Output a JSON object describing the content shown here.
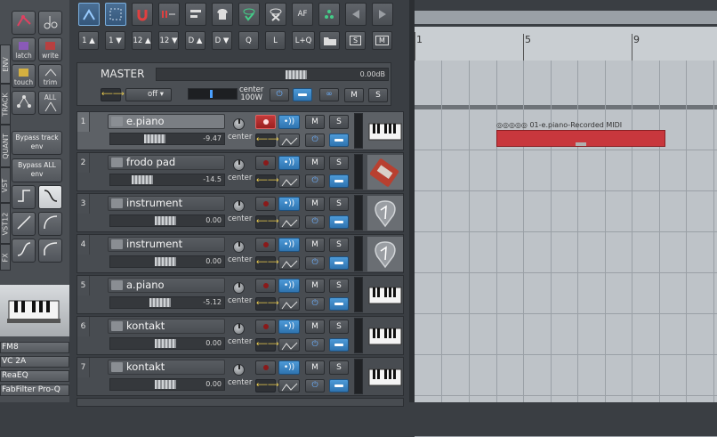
{
  "left_panel": {
    "tabs": [
      "ENV",
      "TRACK",
      "QUANT",
      "VST",
      "VST12",
      "FX"
    ],
    "env_buttons": {
      "latch": "latch",
      "write": "write",
      "touch": "touch",
      "trim": "trim",
      "all": "ALL"
    },
    "bypass_track_env": "Bypass track env",
    "bypass_all_env": "Bypass ALL env",
    "fx_list": [
      "FM8",
      "VC 2A",
      "ReaEQ",
      "FabFilter Pro-Q"
    ]
  },
  "toolbar": {
    "af_label": "AF",
    "row2": [
      "1 ▲",
      "1 ▼",
      "12 ▲",
      "12 ▼",
      "D ▲",
      "D ▼",
      "Q",
      "L",
      "L+Q",
      "",
      "S",
      "M"
    ]
  },
  "master": {
    "name": "MASTER",
    "volume": "0.00dB",
    "pan_center": "center",
    "pan_width": "100W",
    "env_mode": "off",
    "mute": "M",
    "solo": "S"
  },
  "tracks": [
    {
      "num": "1",
      "name": "e.piano",
      "vol": "-9.47",
      "pan": "center",
      "armed": true,
      "icon": "piano-icon",
      "selected": true
    },
    {
      "num": "2",
      "name": "frodo pad",
      "vol": "-14.5",
      "pan": "center",
      "armed": false,
      "icon": "synth-icon",
      "selected": false
    },
    {
      "num": "3",
      "name": "instrument",
      "vol": "0.00",
      "pan": "center",
      "armed": false,
      "icon": "guitar-pick-icon",
      "selected": false
    },
    {
      "num": "4",
      "name": "instrument",
      "vol": "0.00",
      "pan": "center",
      "armed": false,
      "icon": "guitar-pick-icon",
      "selected": false
    },
    {
      "num": "5",
      "name": "a.piano",
      "vol": "-5.12",
      "pan": "center",
      "armed": false,
      "icon": "piano-icon",
      "selected": false
    },
    {
      "num": "6",
      "name": "kontakt",
      "vol": "0.00",
      "pan": "center",
      "armed": false,
      "icon": "piano-icon",
      "selected": false
    },
    {
      "num": "7",
      "name": "kontakt",
      "vol": "0.00",
      "pan": "center",
      "armed": false,
      "icon": "piano-icon",
      "selected": false
    }
  ],
  "track_buttons": {
    "mute": "M",
    "solo": "S",
    "monitor": "•))"
  },
  "arrange": {
    "ruler_marks": [
      "1",
      "5",
      "9"
    ],
    "item_name": "01-e.piano-Recorded MIDI"
  },
  "colors": {
    "item": "#c8373d",
    "accent_blue": "#3a86c8",
    "rec_red": "#c43a3a"
  }
}
